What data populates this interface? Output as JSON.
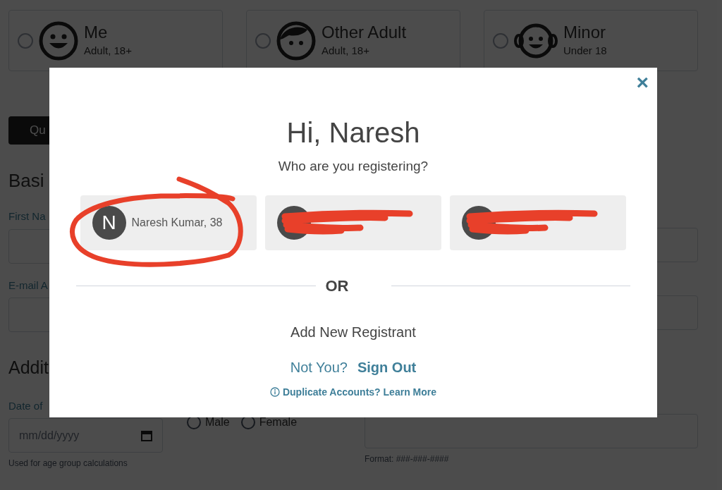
{
  "registrant_types": [
    {
      "title": "Me",
      "subtitle": "Adult, 18+",
      "kind": "smiley",
      "selected": false
    },
    {
      "title": "Other Adult",
      "subtitle": "Adult, 18+",
      "kind": "face",
      "selected": false
    },
    {
      "title": "Minor",
      "subtitle": "Under 18",
      "kind": "baby",
      "selected": false
    }
  ],
  "quick_button": "Qu",
  "basic_heading": "Basi",
  "fields": [
    {
      "label": "First Na"
    },
    {
      "label": "E-mail A"
    }
  ],
  "additional_heading": "Addit",
  "date_of_birth": {
    "label": "Date of",
    "placeholder": "mm/dd/yyyy",
    "hint": "Used for age group calculations"
  },
  "gender_options": [
    {
      "label": "Male",
      "selected": false
    },
    {
      "label": "Female",
      "selected": false
    }
  ],
  "phone": {
    "hint": "Format: ###-###-####"
  },
  "modal": {
    "close": "×",
    "title": "Hi, Naresh",
    "subtitle": "Who are you registering?",
    "registrants": [
      {
        "initial": "N",
        "name": "Naresh Kumar, 38",
        "redacted": false
      },
      {
        "redacted": true
      },
      {
        "redacted": true
      }
    ],
    "divider": "OR",
    "add_new": "Add New Registrant",
    "not_you": "Not You?",
    "sign_out": "Sign Out",
    "duplicate": "Duplicate Accounts? Learn More"
  }
}
